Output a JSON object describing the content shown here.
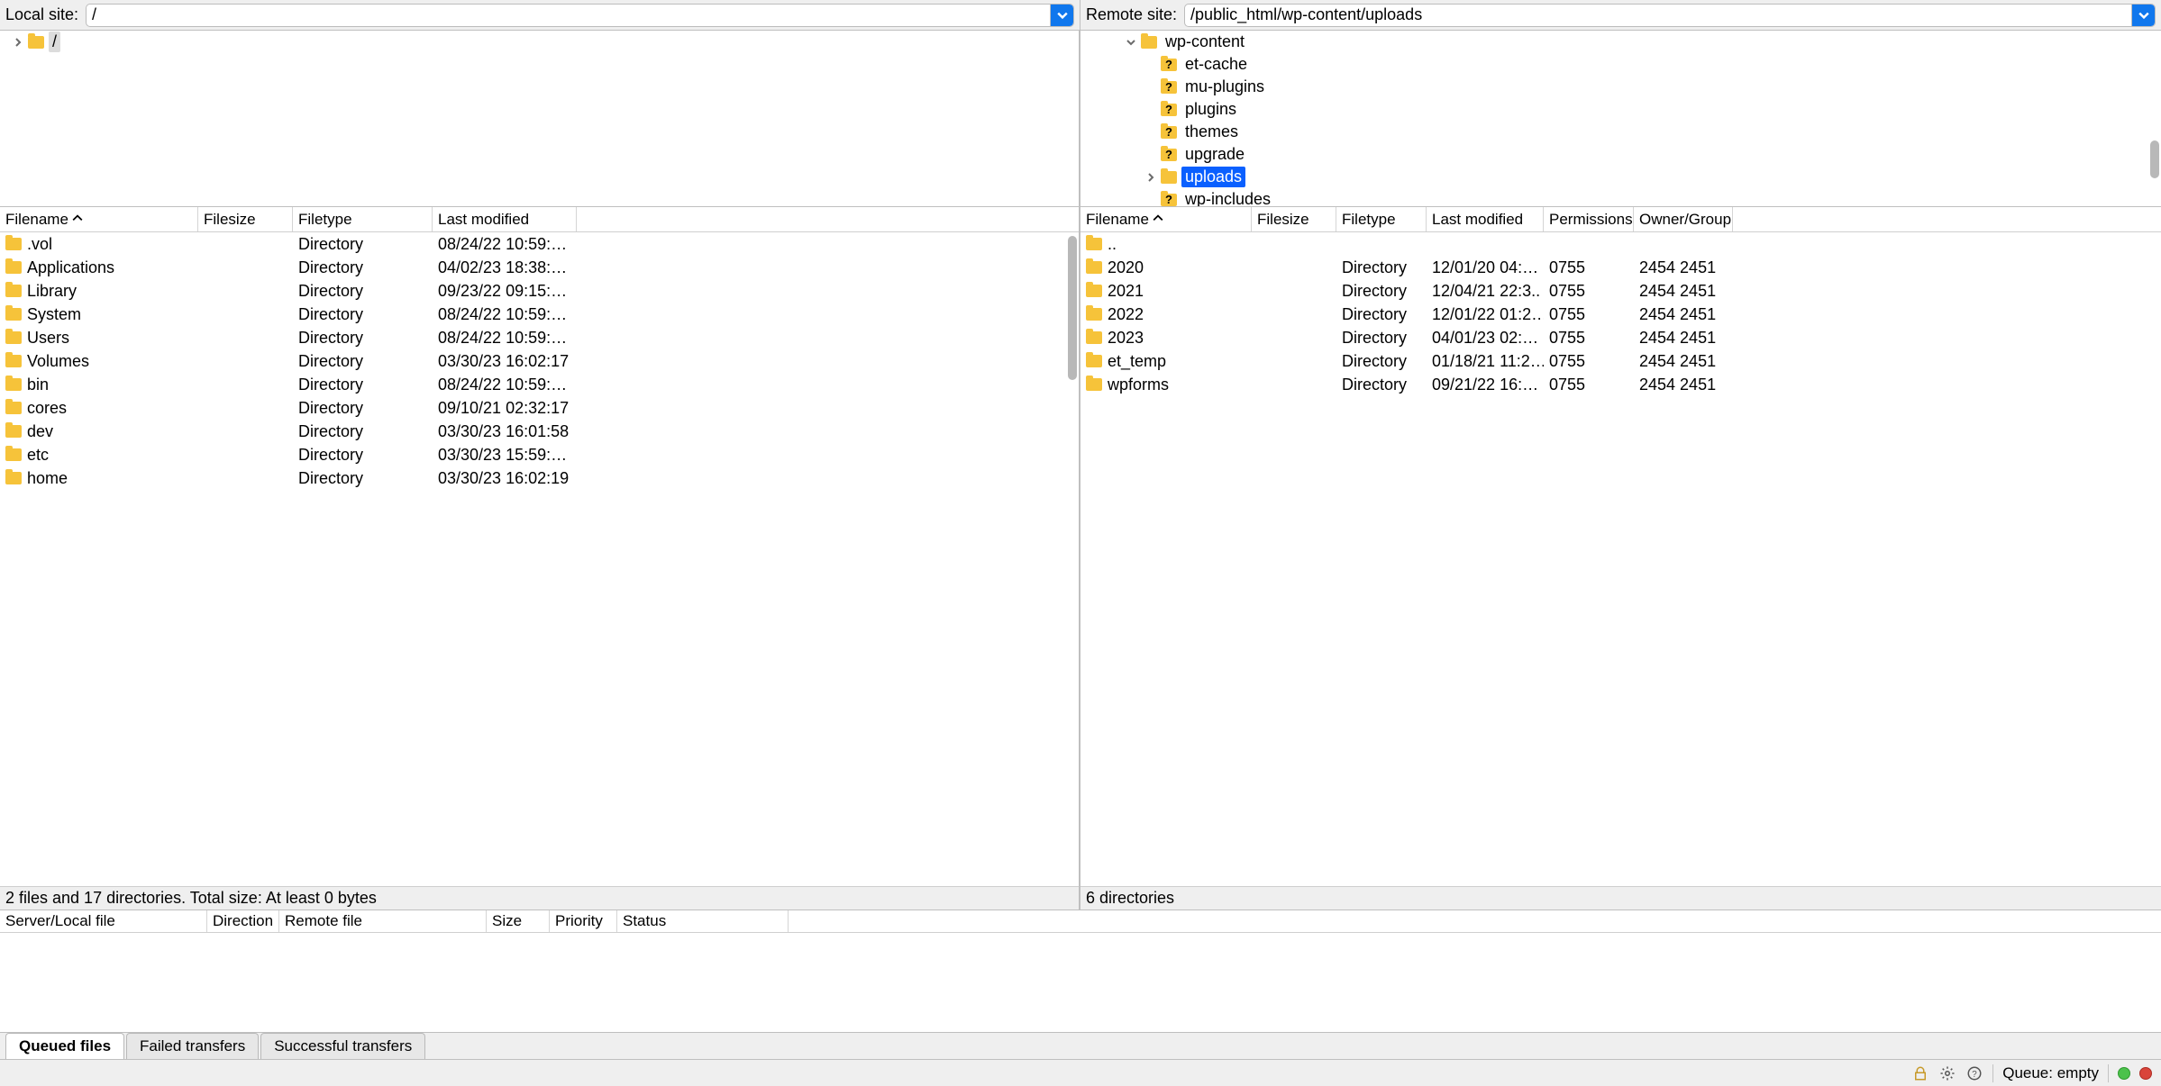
{
  "local": {
    "label": "Local site:",
    "path": "/",
    "tree": [
      {
        "indent": 0,
        "chev": "right",
        "style": "folder",
        "label": "/",
        "selectedBg": true
      }
    ],
    "columns": [
      "Filename",
      "Filesize",
      "Filetype",
      "Last modified"
    ],
    "col_widths": [
      "220px",
      "105px",
      "155px",
      "160px"
    ],
    "sort_col": 0,
    "rows": [
      {
        "name": ".vol",
        "size": "",
        "type": "Directory",
        "mod": "08/24/22 10:59:…"
      },
      {
        "name": "Applications",
        "size": "",
        "type": "Directory",
        "mod": "04/02/23 18:38:…"
      },
      {
        "name": "Library",
        "size": "",
        "type": "Directory",
        "mod": "09/23/22 09:15:…"
      },
      {
        "name": "System",
        "size": "",
        "type": "Directory",
        "mod": "08/24/22 10:59:…"
      },
      {
        "name": "Users",
        "size": "",
        "type": "Directory",
        "mod": "08/24/22 10:59:…"
      },
      {
        "name": "Volumes",
        "size": "",
        "type": "Directory",
        "mod": "03/30/23 16:02:17"
      },
      {
        "name": "bin",
        "size": "",
        "type": "Directory",
        "mod": "08/24/22 10:59:…"
      },
      {
        "name": "cores",
        "size": "",
        "type": "Directory",
        "mod": "09/10/21 02:32:17"
      },
      {
        "name": "dev",
        "size": "",
        "type": "Directory",
        "mod": "03/30/23 16:01:58"
      },
      {
        "name": "etc",
        "size": "",
        "type": "Directory",
        "mod": "03/30/23 15:59:…"
      },
      {
        "name": "home",
        "size": "",
        "type": "Directory",
        "mod": "03/30/23 16:02:19"
      }
    ],
    "status": "2 files and 17 directories. Total size: At least 0 bytes"
  },
  "remote": {
    "label": "Remote site:",
    "path": "/public_html/wp-content/uploads",
    "tree": [
      {
        "indent": 0,
        "chev": "down",
        "style": "folder",
        "label": "wp-content"
      },
      {
        "indent": 1,
        "chev": "",
        "style": "folderq",
        "label": "et-cache"
      },
      {
        "indent": 1,
        "chev": "",
        "style": "folderq",
        "label": "mu-plugins"
      },
      {
        "indent": 1,
        "chev": "",
        "style": "folderq",
        "label": "plugins"
      },
      {
        "indent": 1,
        "chev": "",
        "style": "folderq",
        "label": "themes"
      },
      {
        "indent": 1,
        "chev": "",
        "style": "folderq",
        "label": "upgrade"
      },
      {
        "indent": 1,
        "chev": "right",
        "style": "folder",
        "label": "uploads",
        "selected": true
      },
      {
        "indent": 1,
        "chev": "",
        "style": "folderq",
        "label": "wp-includes"
      }
    ],
    "columns": [
      "Filename",
      "Filesize",
      "Filetype",
      "Last modified",
      "Permissions",
      "Owner/Group"
    ],
    "col_widths": [
      "190px",
      "94px",
      "100px",
      "130px",
      "100px",
      "110px"
    ],
    "sort_col": 0,
    "rows": [
      {
        "name": "..",
        "size": "",
        "type": "",
        "mod": "",
        "perm": "",
        "own": ""
      },
      {
        "name": "2020",
        "size": "",
        "type": "Directory",
        "mod": "12/01/20 04:…",
        "perm": "0755",
        "own": "2454 2451"
      },
      {
        "name": "2021",
        "size": "",
        "type": "Directory",
        "mod": "12/04/21 22:3..",
        "perm": "0755",
        "own": "2454 2451"
      },
      {
        "name": "2022",
        "size": "",
        "type": "Directory",
        "mod": "12/01/22 01:2…",
        "perm": "0755",
        "own": "2454 2451"
      },
      {
        "name": "2023",
        "size": "",
        "type": "Directory",
        "mod": "04/01/23 02:…",
        "perm": "0755",
        "own": "2454 2451"
      },
      {
        "name": "et_temp",
        "size": "",
        "type": "Directory",
        "mod": "01/18/21 11:2…",
        "perm": "0755",
        "own": "2454 2451"
      },
      {
        "name": "wpforms",
        "size": "",
        "type": "Directory",
        "mod": "09/21/22 16:…",
        "perm": "0755",
        "own": "2454 2451"
      }
    ],
    "status": "6 directories"
  },
  "queue": {
    "columns": [
      "Server/Local file",
      "Direction",
      "Remote file",
      "Size",
      "Priority",
      "Status"
    ],
    "col_widths": [
      "230px",
      "80px",
      "230px",
      "70px",
      "75px",
      "190px"
    ]
  },
  "tabs": {
    "items": [
      "Queued files",
      "Failed transfers",
      "Successful transfers"
    ],
    "active": 0
  },
  "statusbar": {
    "queue": "Queue: empty"
  }
}
